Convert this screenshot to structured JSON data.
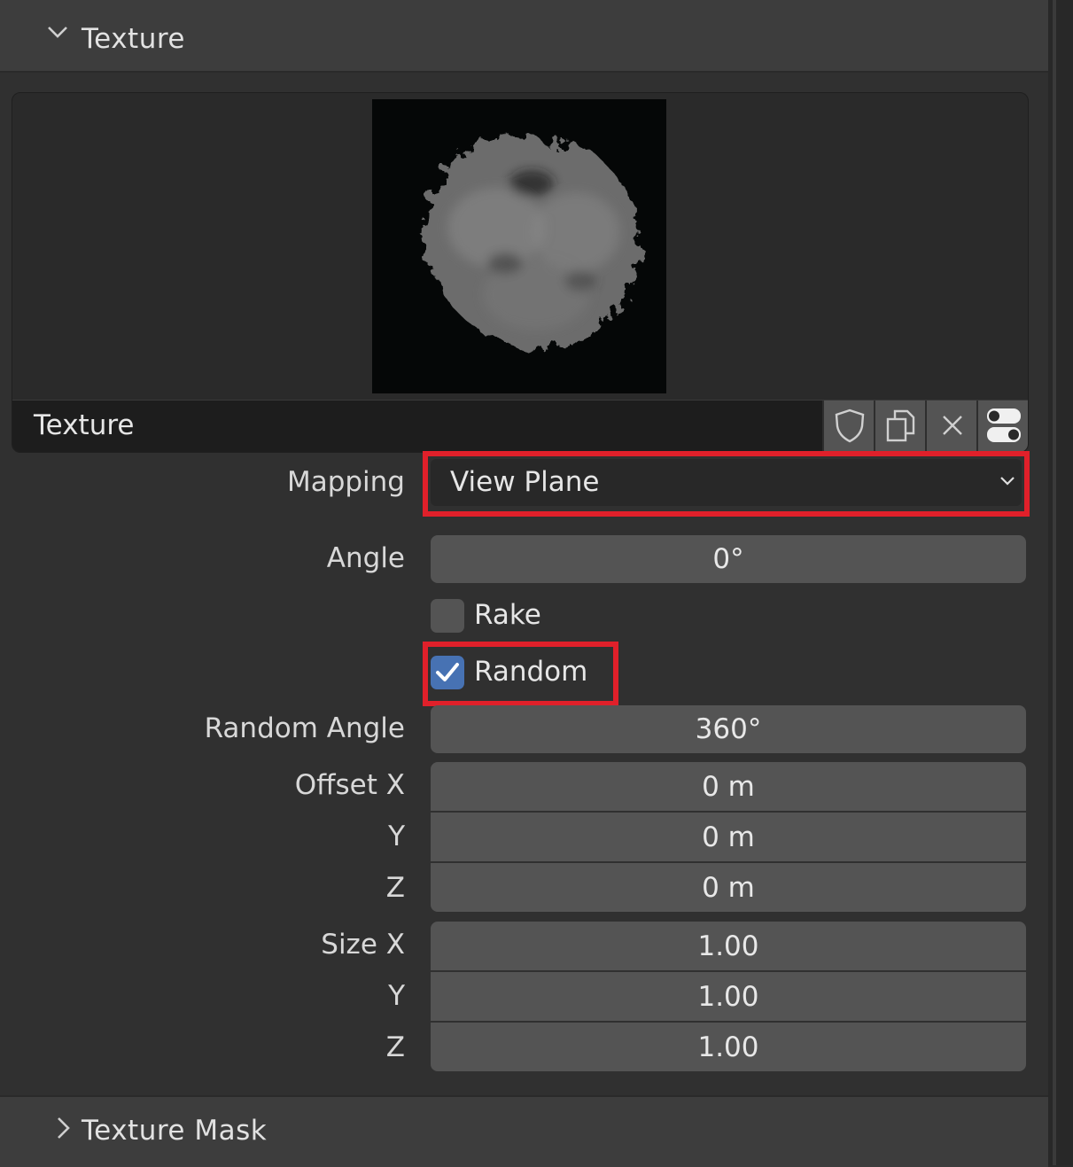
{
  "panel": {
    "title": "Texture",
    "texture_slot": {
      "name": "Texture",
      "buttons": [
        "fake-user",
        "duplicate",
        "unlink",
        "browse"
      ]
    },
    "mapping": {
      "label": "Mapping",
      "value": "View Plane"
    },
    "angle": {
      "label": "Angle",
      "value": "0°"
    },
    "rake": {
      "label": "Rake",
      "checked": false
    },
    "random": {
      "label": "Random",
      "checked": true
    },
    "random_angle": {
      "label": "Random Angle",
      "value": "360°"
    },
    "offset": {
      "x": {
        "label": "Offset X",
        "value": "0 m"
      },
      "y": {
        "label": "Y",
        "value": "0 m"
      },
      "z": {
        "label": "Z",
        "value": "0 m"
      }
    },
    "size": {
      "x": {
        "label": "Size X",
        "value": "1.00"
      },
      "y": {
        "label": "Y",
        "value": "1.00"
      },
      "z": {
        "label": "Z",
        "value": "1.00"
      }
    }
  },
  "next_panel": {
    "title": "Texture Mask"
  },
  "colors": {
    "highlight": "#e0202a",
    "checkbox_on": "#4772b3",
    "field": "#545454"
  }
}
